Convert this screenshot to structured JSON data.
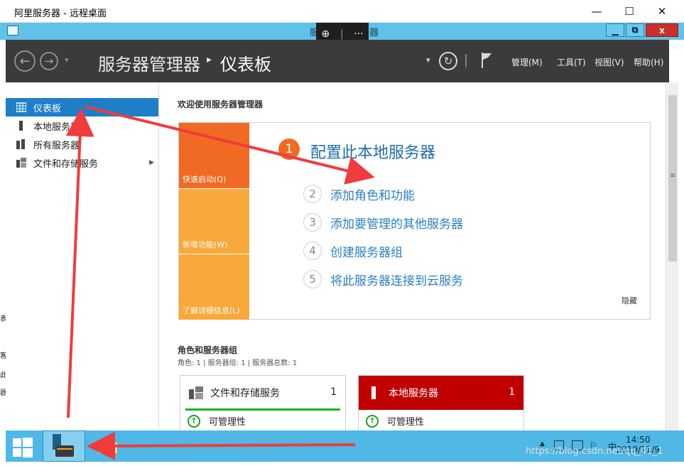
{
  "rdp_window": {
    "title": "阿里服务器 - 远程桌面",
    "minimize": "—",
    "maximize": "☐",
    "close": "✕",
    "toolbar_zoom": "⊕",
    "toolbar_sep": "|",
    "toolbar_more": "···"
  },
  "server_window": {
    "title_fragment_left": "服",
    "title_fragment_right": "器",
    "min_btn": "▁",
    "restore_btn": "⧉",
    "close_btn": "x"
  },
  "header": {
    "breadcrumb_root": "服务器管理器",
    "breadcrumb_sep": "▸",
    "breadcrumb_current": "仪表板",
    "back_icon": "←",
    "forward_icon": "→",
    "dropdown_icon": "▾",
    "pipe": "|",
    "refresh_icon": "↻",
    "menus": [
      "管理(M)",
      "工具(T)",
      "视图(V)",
      "帮助(H)"
    ]
  },
  "sidebar": {
    "items": [
      {
        "label": "仪表板",
        "active": true
      },
      {
        "label": "本地服务器",
        "active": false
      },
      {
        "label": "所有服务器",
        "active": false
      },
      {
        "label": "文件和存储服务",
        "active": false,
        "arrow": "▶"
      }
    ]
  },
  "main": {
    "welcome_title": "欢迎使用服务器管理器",
    "tiles": [
      "快速启动(Q)",
      "新增功能(W)",
      "了解详细信息(L)"
    ],
    "step1": {
      "number": "1",
      "label": "配置此本地服务器"
    },
    "steps": [
      {
        "number": "2",
        "label": "添加角色和功能"
      },
      {
        "number": "3",
        "label": "添加要管理的其他服务器"
      },
      {
        "number": "4",
        "label": "创建服务器组"
      },
      {
        "number": "5",
        "label": "将此服务器连接到云服务"
      }
    ],
    "hide_label": "隐藏",
    "roles_title": "角色和服务器组",
    "roles_subtitle": "角色: 1 | 服务器组: 1 | 服务器总数: 1",
    "cards": [
      {
        "name": "文件和存储服务",
        "count": "1",
        "status": "可管理性"
      },
      {
        "name": "本地服务器",
        "count": "1",
        "status": "可管理性"
      }
    ],
    "status_icon": "↑"
  },
  "scrollbar": {
    "grip": "≡"
  },
  "taskbar": {
    "tray_caret": "▲",
    "tray_ime": "中",
    "tray_flag": "⚐",
    "time": "14:50",
    "date": "2019/11/9"
  },
  "watermark": "https://blog.csdn.net/qq_41_1",
  "left_fragments": [
    "表",
    "客",
    "此",
    "器"
  ],
  "colors": {
    "accent_blue": "#1e7fc8",
    "header_dark": "#3b3b3b",
    "quick_start_orange": "#f06a23",
    "tile_yellow": "#f9a83a",
    "local_server_red": "#c00000",
    "ok_green": "#16b51e",
    "annotation_red": "#f03c3c"
  }
}
